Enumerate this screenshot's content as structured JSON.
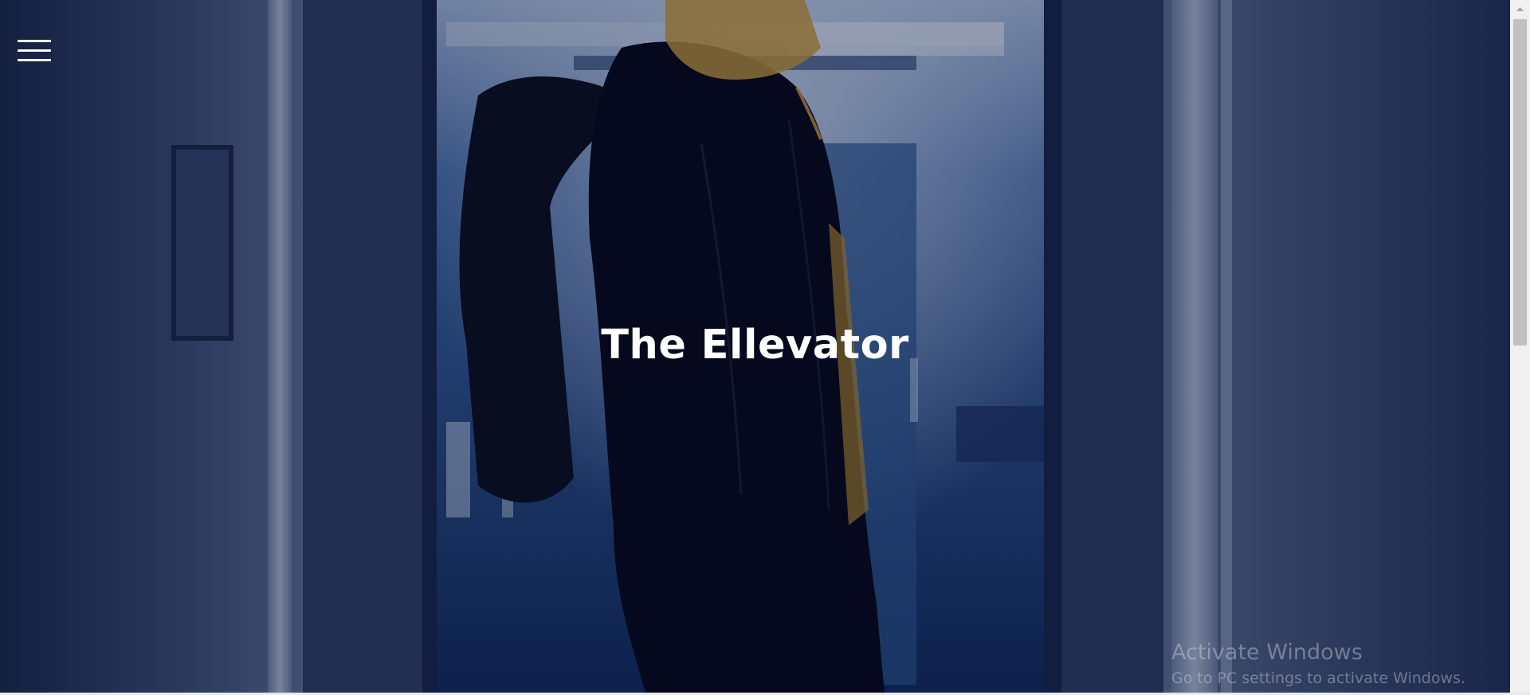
{
  "hero": {
    "title": "The Ellevator",
    "image_icon": "hero-photo-person-in-elevator"
  },
  "nav": {
    "menu_icon": "hamburger-menu-icon"
  },
  "watermark": {
    "title": "Activate Windows",
    "subtitle": "Go to PC settings to activate Windows."
  },
  "colors": {
    "title_text": "#ffffff",
    "hero_tint": "#1d2c52",
    "scrollbar_track": "#f0f0f0",
    "scrollbar_thumb": "#c1c1c1"
  }
}
